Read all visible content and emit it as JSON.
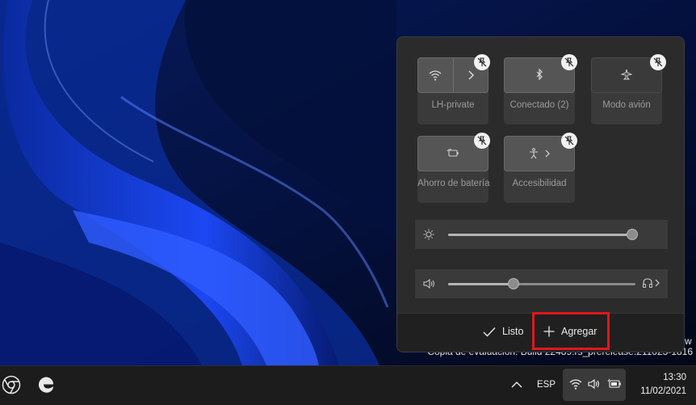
{
  "quick_settings": {
    "tiles": [
      {
        "id": "wifi",
        "label": "LH-private",
        "icon": "wifi-icon"
      },
      {
        "id": "bluetooth",
        "label": "Conectado (2)",
        "icon": "bluetooth-icon"
      },
      {
        "id": "airplane",
        "label": "Modo avión",
        "icon": "airplane-icon"
      },
      {
        "id": "battery-saver",
        "label": "Ahorro de batería",
        "icon": "battery-saver-icon"
      },
      {
        "id": "accessibility",
        "label": "Accesibilidad",
        "icon": "accessibility-icon"
      }
    ],
    "brightness": {
      "icon": "brightness-icon",
      "level": 1.0
    },
    "volume": {
      "icon": "speaker-icon",
      "level": 0.35,
      "output_icon": "headphones-icon"
    },
    "footer": {
      "done_label": "Listo",
      "add_label": "Agregar"
    }
  },
  "watermark": {
    "line1": "Copia de evaluación. Build 22489.rs_prerelease.211023-1816",
    "trailing_char": "w"
  },
  "taskbar": {
    "pinned": [
      {
        "name": "chrome-icon"
      },
      {
        "name": "edge-icon"
      }
    ],
    "tray": {
      "overflow_icon": "chevron-up-icon",
      "language": "ESP",
      "icons": [
        "wifi-icon",
        "volume-icon",
        "battery-icon"
      ]
    },
    "clock": {
      "time": "13:30",
      "date": "11/02/2021"
    }
  },
  "colors": {
    "highlight": "#e0161e",
    "panel_bg": "#2b2b2b",
    "taskbar_bg": "#1c1c1c"
  }
}
